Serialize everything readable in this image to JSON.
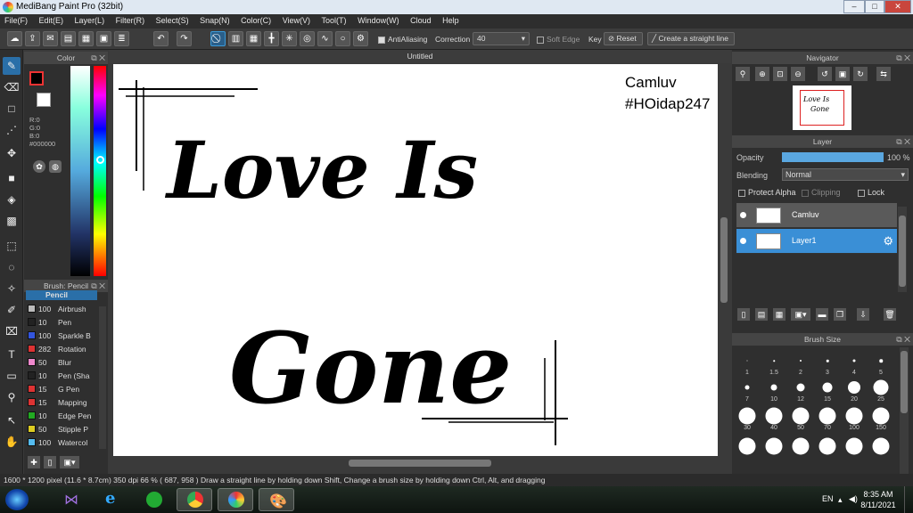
{
  "window": {
    "title": "MediBang Paint Pro (32bit)",
    "min": "–",
    "max": "□",
    "close": "✕"
  },
  "menu": [
    "File(F)",
    "Edit(E)",
    "Layer(L)",
    "Filter(R)",
    "Select(S)",
    "Snap(N)",
    "Color(C)",
    "View(V)",
    "Tool(T)",
    "Window(W)",
    "Cloud",
    "Help"
  ],
  "toolbar": {
    "antialiasing_label": "AntiAliasing",
    "correction_label": "Correction",
    "correction_value": "40",
    "soft_edge_label": "Soft Edge",
    "key_label": "Key",
    "reset_label": "Reset",
    "straight_line_label": "Create a straight line"
  },
  "color_panel": {
    "title": "Color",
    "rgb": {
      "r": "R:0",
      "g": "G:0",
      "b": "B:0"
    },
    "hex": "#000000",
    "primary_color": "#000000",
    "secondary_color": "#ffffff"
  },
  "brush_panel": {
    "title": "Brush: Pencil",
    "current": "Pencil",
    "brushes": [
      {
        "size": "100",
        "name": "Airbrush",
        "color": "#bbbbbb"
      },
      {
        "size": "10",
        "name": "Pen",
        "color": "#222222"
      },
      {
        "size": "100",
        "name": "Sparkle B",
        "color": "#3355dd"
      },
      {
        "size": "282",
        "name": "Rotation",
        "color": "#dd3333"
      },
      {
        "size": "50",
        "name": "Blur",
        "color": "#ee88cc"
      },
      {
        "size": "10",
        "name": "Pen (Sha",
        "color": "#222222"
      },
      {
        "size": "15",
        "name": "G Pen",
        "color": "#dd3333"
      },
      {
        "size": "15",
        "name": "Mapping",
        "color": "#dd3333"
      },
      {
        "size": "10",
        "name": "Edge Pen",
        "color": "#22aa22"
      },
      {
        "size": "50",
        "name": "Stipple P",
        "color": "#ddcc22"
      },
      {
        "size": "100",
        "name": "Watercol",
        "color": "#55bbee"
      }
    ]
  },
  "canvas": {
    "tab_title": "Untitled",
    "watermark_line1": "Camluv",
    "watermark_line2": "#HOidap247",
    "art_line1": "Love Is",
    "art_line2": "Gone"
  },
  "navigator": {
    "title": "Navigator"
  },
  "layer_panel": {
    "title": "Layer",
    "opacity_label": "Opacity",
    "opacity_value": "100 %",
    "opacity_fraction": 1.0,
    "blending_label": "Blending",
    "blending_value": "Normal",
    "protect_alpha_label": "Protect Alpha",
    "clipping_label": "Clipping",
    "lock_label": "Lock",
    "layers": [
      {
        "name": "Camluv",
        "selected": false
      },
      {
        "name": "Layer1",
        "selected": true
      }
    ]
  },
  "brush_size_panel": {
    "title": "Brush Size",
    "sizes": [
      "1",
      "1.5",
      "2",
      "3",
      "4",
      "5",
      "7",
      "10",
      "12",
      "15",
      "20",
      "25",
      "30",
      "40",
      "50",
      "70",
      "100",
      "150"
    ]
  },
  "status": {
    "text": "1600 * 1200 pixel   (11.6 * 8.7cm)   350 dpi   66 %   ( 687, 958 )   Draw a straight line by holding down Shift, Change a brush size by holding down Ctrl, Alt, and dragging"
  },
  "taskbar": {
    "lang": "EN",
    "time": "8:35 AM",
    "date": "8/11/2021"
  }
}
